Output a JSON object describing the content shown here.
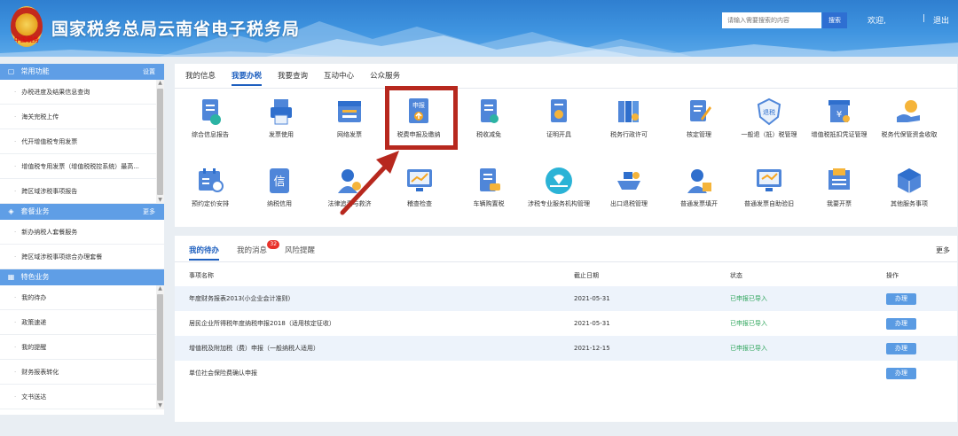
{
  "header": {
    "emblem_text": "中国税务",
    "site_title": "国家税务总局云南省电子税务局",
    "search_placeholder": "请输入需要搜索的内容",
    "search_button": "搜索",
    "welcome": "欢迎,",
    "separator": "|",
    "logout": "退出"
  },
  "sidebar": {
    "sections": [
      {
        "title": "常用功能",
        "more": "设置",
        "icon": "monitor-icon",
        "items": [
          "办税进度及结果信息查询",
          "海关完税上传",
          "代开增值税专用发票",
          "增值税专用发票（增值税税控系统）最高...",
          "跨区域涉税事项报告"
        ]
      },
      {
        "title": "套餐业务",
        "more": "更多",
        "icon": "layers-icon",
        "items": [
          "新办纳税人套餐服务",
          "跨区域涉税事项综合办理套餐"
        ]
      },
      {
        "title": "特色业务",
        "more": "",
        "icon": "grid-icon",
        "items": [
          "我的待办",
          "政策速递",
          "我的提醒",
          "财务报表转化",
          "文书送达"
        ]
      }
    ]
  },
  "main": {
    "tabs": [
      "我的信息",
      "我要办税",
      "我要查询",
      "互动中心",
      "公众服务"
    ],
    "active_tab": 1,
    "services": [
      {
        "label": "综合信息报告",
        "icon": "report-icon"
      },
      {
        "label": "发票使用",
        "icon": "printer-icon"
      },
      {
        "label": "网络发票",
        "icon": "web-invoice-icon"
      },
      {
        "label": "税费申报及缴纳",
        "icon": "declare-upload-icon",
        "icon_text": "申报"
      },
      {
        "label": "税收减免",
        "icon": "tax-relief-icon"
      },
      {
        "label": "证明开具",
        "icon": "certificate-icon"
      },
      {
        "label": "税务行政许可",
        "icon": "binders-icon"
      },
      {
        "label": "核定管理",
        "icon": "edit-doc-icon"
      },
      {
        "label": "一般退（抵）税管理",
        "icon": "refund-shield-icon",
        "icon_text": "退税"
      },
      {
        "label": "增值税抵扣凭证管理",
        "icon": "voucher-icon"
      },
      {
        "label": "税务代保管资金收取",
        "icon": "hand-money-icon"
      },
      {
        "label": "预约定价安排",
        "icon": "calendar-icon"
      },
      {
        "label": "纳税信用",
        "icon": "credit-icon",
        "icon_text": "信"
      },
      {
        "label": "法律追责与救济",
        "icon": "legal-user-icon"
      },
      {
        "label": "稽查检查",
        "icon": "monitor-chart-icon"
      },
      {
        "label": "车辆购置税",
        "icon": "vehicle-doc-icon"
      },
      {
        "label": "涉税专业服务机构管理",
        "icon": "heart-hand-icon"
      },
      {
        "label": "出口退税管理",
        "icon": "ship-icon"
      },
      {
        "label": "普通发票填开",
        "icon": "user-invoice-icon"
      },
      {
        "label": "普通发票自助验旧",
        "icon": "monitor-check-icon"
      },
      {
        "label": "我要开票",
        "icon": "invoice-open-icon"
      },
      {
        "label": "其他服务事项",
        "icon": "cube-icon"
      }
    ]
  },
  "todo": {
    "tabs": [
      "我的待办",
      "我的消息",
      "风险提醒"
    ],
    "active_tab": 0,
    "message_badge": "32",
    "more": "更多",
    "columns": [
      "事项名称",
      "截止日期",
      "状态",
      "操作"
    ],
    "rows": [
      {
        "name": "年度财务报表2013(小企业会计准则)",
        "date": "2021-05-31",
        "status": "已申报已导入",
        "action": "办理"
      },
      {
        "name": "居民企业所得税年度纳税申报2018（适用核定征收）",
        "date": "2021-05-31",
        "status": "已申报已导入",
        "action": "办理"
      },
      {
        "name": "增值税及附加税（费）申报（一般纳税人适用）",
        "date": "2021-12-15",
        "status": "已申报已导入",
        "action": "办理"
      },
      {
        "name": "单位社会保险费确认申报",
        "date": "",
        "status": "",
        "action": "办理"
      }
    ]
  },
  "colors": {
    "header_blue": "#3f94e0",
    "sidebar_header": "#5f9ee6",
    "active_tab": "#1d5fbf",
    "status_green": "#2ea55b",
    "highlight_red": "#b7281e",
    "badge_red": "#e8322b"
  }
}
